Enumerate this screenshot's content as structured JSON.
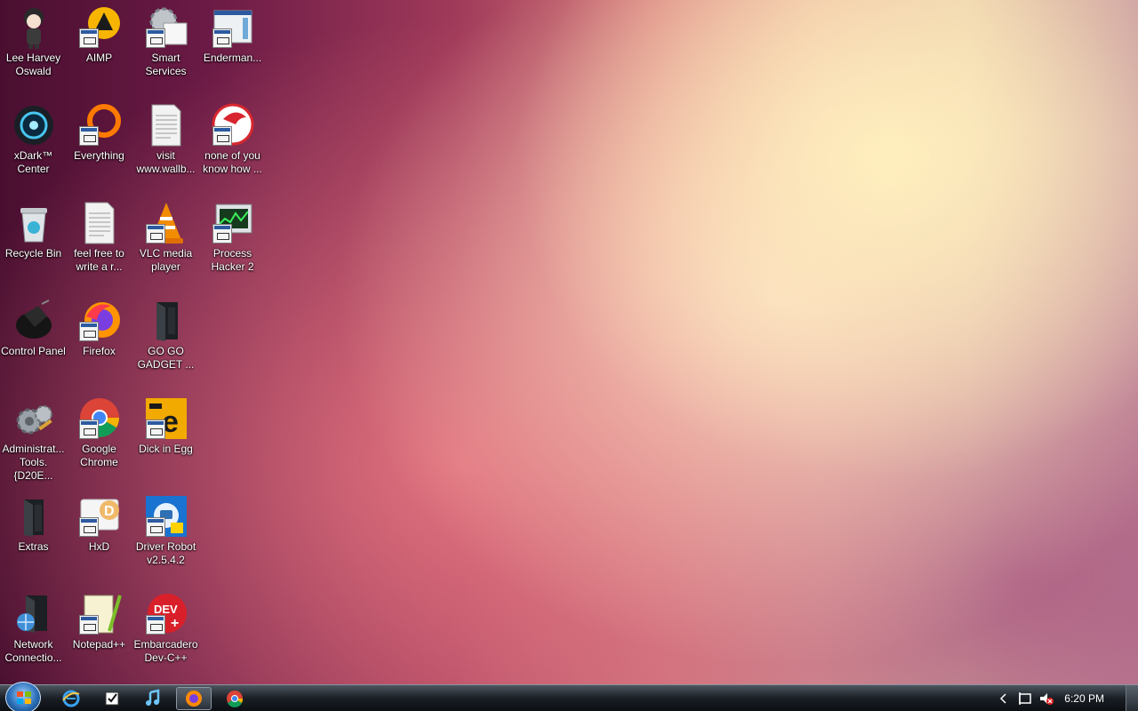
{
  "desktop": {
    "icons": [
      {
        "label": "Lee Harvey Oswald",
        "icon": "anime-character-icon"
      },
      {
        "label": "AIMP",
        "icon": "aimp-icon"
      },
      {
        "label": "Smart Services",
        "icon": "gear-icon"
      },
      {
        "label": "Enderman...",
        "icon": "window-app-icon"
      },
      {
        "label": "xDark™ Center",
        "icon": "xdark-icon"
      },
      {
        "label": "Everything",
        "icon": "everything-icon"
      },
      {
        "label": "visit www.wallb...",
        "icon": "text-document-icon"
      },
      {
        "label": "none of you know how ...",
        "icon": "red-circle-app-icon"
      },
      {
        "label": "Recycle Bin",
        "icon": "recycle-bin-icon"
      },
      {
        "label": "feel free to write a r...",
        "icon": "text-document-icon"
      },
      {
        "label": "VLC media player",
        "icon": "vlc-icon"
      },
      {
        "label": "Process Hacker 2",
        "icon": "process-hacker-icon"
      },
      {
        "label": "Control Panel",
        "icon": "control-panel-icon"
      },
      {
        "label": "Firefox",
        "icon": "firefox-icon"
      },
      {
        "label": "GO GO GADGET ...",
        "icon": "dark-folder-icon"
      },
      {
        "label": "Administrat... Tools.{D20E...",
        "icon": "admin-tools-icon"
      },
      {
        "label": "Google Chrome",
        "icon": "chrome-icon"
      },
      {
        "label": "Dick in Egg",
        "icon": "egg-app-icon"
      },
      {
        "label": "Extras",
        "icon": "dark-folder-icon"
      },
      {
        "label": "HxD",
        "icon": "hxd-icon"
      },
      {
        "label": "Driver Robot v2.5.4.2",
        "icon": "driver-robot-icon"
      },
      {
        "label": "Network Connectio...",
        "icon": "network-folder-icon"
      },
      {
        "label": "Notepad++",
        "icon": "notepad-plus-plus-icon"
      },
      {
        "label": "Embarcadero Dev-C++",
        "icon": "dev-cpp-icon"
      }
    ]
  },
  "taskbar": {
    "pinned": [
      "internet-explorer-icon",
      "task-checkbox-icon",
      "itunes-icon",
      "firefox-icon",
      "chrome-icon"
    ],
    "clock": "6:20 PM"
  }
}
